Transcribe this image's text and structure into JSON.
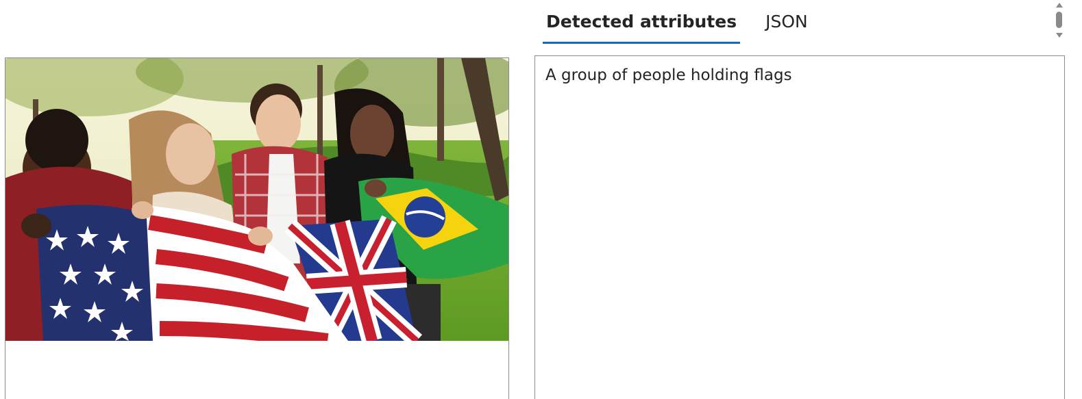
{
  "tabs": [
    {
      "label": "Detected attributes",
      "active": true
    },
    {
      "label": "JSON",
      "active": false
    }
  ],
  "result": {
    "caption": "A group of people holding flags"
  },
  "image": {
    "flags_shown": [
      "United States",
      "United Kingdom",
      "Brazil"
    ]
  },
  "colors": {
    "accent": "#0f6cbd",
    "border": "#8a8a8a",
    "text": "#242424"
  }
}
